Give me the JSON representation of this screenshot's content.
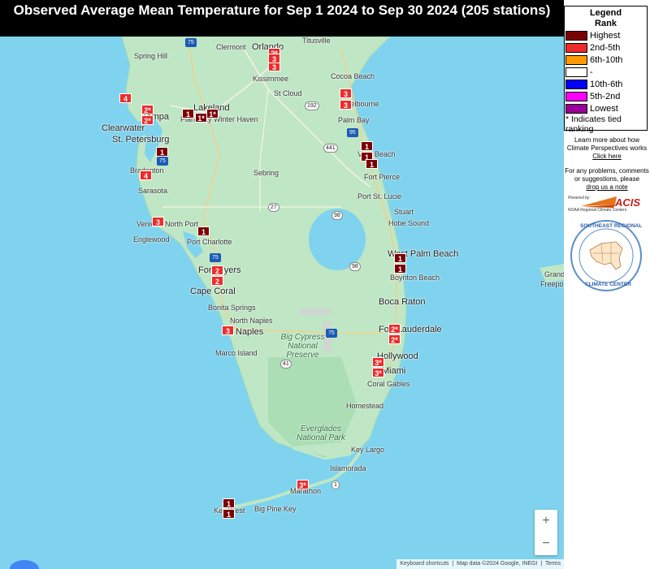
{
  "title": "Observed Average Mean Temperature for Sep 1 2024 to Sep 30 2024 (205 stations)",
  "legend": {
    "title_line1": "Legend",
    "title_line2": "Rank",
    "items": [
      {
        "label": "Highest",
        "color": "#7b0000"
      },
      {
        "label": "2nd-5th",
        "color": "#ee2b2b"
      },
      {
        "label": "6th-10th",
        "color": "#ff9900"
      },
      {
        "label": "-",
        "color": "#ffffff"
      },
      {
        "label": "10th-6th",
        "color": "#0000ff"
      },
      {
        "label": "5th-2nd",
        "color": "#ff00ff"
      },
      {
        "label": "Lowest",
        "color": "#990099"
      }
    ],
    "note": "* Indicates tied ranking"
  },
  "sidebar": {
    "learn_text": "Learn more about how Climate Perspectives works",
    "click_here": "Click here",
    "problems_text": "For any problems, comments or suggestions, please",
    "drop_note": "drop us a note",
    "acis_powered": "Powered by",
    "acis_name": "ACIS",
    "acis_sub": "NOAA Regional Climate Centers",
    "serc_top": "SOUTHEAST REGIONAL",
    "serc_bottom": "CLIMATE CENTER"
  },
  "map": {
    "attribution": {
      "shortcuts": "Keyboard shortcuts",
      "data": "Map data ©2024 Google, INEGI",
      "terms": "Terms"
    },
    "places": [
      {
        "name": "Titusville",
        "cls": ""
      },
      {
        "name": "Spring Hill",
        "cls": ""
      },
      {
        "name": "Clermont",
        "cls": ""
      },
      {
        "name": "Orlando",
        "cls": "big"
      },
      {
        "name": "Kissimmee",
        "cls": ""
      },
      {
        "name": "Cocoa Beach",
        "cls": ""
      },
      {
        "name": "Lakeland",
        "cls": "big"
      },
      {
        "name": "Winter Haven",
        "cls": ""
      },
      {
        "name": "Plant City",
        "cls": ""
      },
      {
        "name": "Tampa",
        "cls": "big"
      },
      {
        "name": "Clearwater",
        "cls": "big"
      },
      {
        "name": "St. Petersburg",
        "cls": "big"
      },
      {
        "name": "St Cloud",
        "cls": ""
      },
      {
        "name": "Melbourne",
        "cls": ""
      },
      {
        "name": "Palm Bay",
        "cls": ""
      },
      {
        "name": "Vero Beach",
        "cls": ""
      },
      {
        "name": "Fort Pierce",
        "cls": ""
      },
      {
        "name": "Sebring",
        "cls": ""
      },
      {
        "name": "Bradenton",
        "cls": ""
      },
      {
        "name": "Sarasota",
        "cls": ""
      },
      {
        "name": "Port St. Lucie",
        "cls": ""
      },
      {
        "name": "Stuart",
        "cls": ""
      },
      {
        "name": "Hobe Sound",
        "cls": ""
      },
      {
        "name": "North Port",
        "cls": ""
      },
      {
        "name": "Venice",
        "cls": ""
      },
      {
        "name": "Englewood",
        "cls": ""
      },
      {
        "name": "Port Charlotte",
        "cls": ""
      },
      {
        "name": "West Palm Beach",
        "cls": "big"
      },
      {
        "name": "Fort Myers",
        "cls": "big"
      },
      {
        "name": "Cape Coral",
        "cls": "big"
      },
      {
        "name": "Boynton Beach",
        "cls": ""
      },
      {
        "name": "Bonita Springs",
        "cls": ""
      },
      {
        "name": "Boca Raton",
        "cls": "big"
      },
      {
        "name": "North Naples",
        "cls": ""
      },
      {
        "name": "Naples",
        "cls": "big"
      },
      {
        "name": "Fort Lauderdale",
        "cls": "big"
      },
      {
        "name": "Marco Island",
        "cls": ""
      },
      {
        "name": "Hollywood",
        "cls": "big"
      },
      {
        "name": "Miami",
        "cls": "big"
      },
      {
        "name": "Coral Gables",
        "cls": ""
      },
      {
        "name": "Homestead",
        "cls": ""
      },
      {
        "name": "Key Largo",
        "cls": ""
      },
      {
        "name": "Islamorada",
        "cls": ""
      },
      {
        "name": "Marathon",
        "cls": ""
      },
      {
        "name": "Big Pine Key",
        "cls": ""
      },
      {
        "name": "Key West",
        "cls": ""
      },
      {
        "name": "Grand",
        "cls": ""
      },
      {
        "name": "Freeport",
        "cls": ""
      }
    ],
    "parks": [
      {
        "name": "Big Cypress National Preserve"
      },
      {
        "name": "Everglades National Park"
      }
    ],
    "shields": [
      {
        "label": "75",
        "type": "i"
      },
      {
        "label": "192",
        "type": "s"
      },
      {
        "label": "95",
        "type": "i"
      },
      {
        "label": "441",
        "type": "s"
      },
      {
        "label": "98",
        "type": "s"
      },
      {
        "label": "27",
        "type": "s"
      },
      {
        "label": "98",
        "type": "s"
      },
      {
        "label": "75",
        "type": "i"
      },
      {
        "label": "41",
        "type": "s"
      },
      {
        "label": "1",
        "type": "s"
      },
      {
        "label": "75",
        "type": "i"
      },
      {
        "label": "75",
        "type": "i"
      }
    ],
    "stations": [
      {
        "rank": "2*",
        "level": 2
      },
      {
        "rank": "3",
        "level": 3
      },
      {
        "rank": "3",
        "level": 3
      },
      {
        "rank": "4",
        "level": 4
      },
      {
        "rank": "2*",
        "level": 2
      },
      {
        "rank": "2*",
        "level": 2
      },
      {
        "rank": "1",
        "level": 1
      },
      {
        "rank": "1*",
        "level": 1
      },
      {
        "rank": "1*",
        "level": 1
      },
      {
        "rank": "3",
        "level": 3
      },
      {
        "rank": "3",
        "level": 3
      },
      {
        "rank": "1",
        "level": 1
      },
      {
        "rank": "1",
        "level": 1
      },
      {
        "rank": "1",
        "level": 1
      },
      {
        "rank": "1",
        "level": 1
      },
      {
        "rank": "4",
        "level": 4
      },
      {
        "rank": "3",
        "level": 3
      },
      {
        "rank": "1",
        "level": 1
      },
      {
        "rank": "1",
        "level": 1
      },
      {
        "rank": "1",
        "level": 1
      },
      {
        "rank": "2",
        "level": 2
      },
      {
        "rank": "2",
        "level": 2
      },
      {
        "rank": "3",
        "level": 3
      },
      {
        "rank": "2*",
        "level": 2
      },
      {
        "rank": "2*",
        "level": 2
      },
      {
        "rank": "3*",
        "level": 3
      },
      {
        "rank": "3*",
        "level": 3
      },
      {
        "rank": "3*",
        "level": 3
      },
      {
        "rank": "1",
        "level": 1
      },
      {
        "rank": "1",
        "level": 1
      }
    ]
  }
}
